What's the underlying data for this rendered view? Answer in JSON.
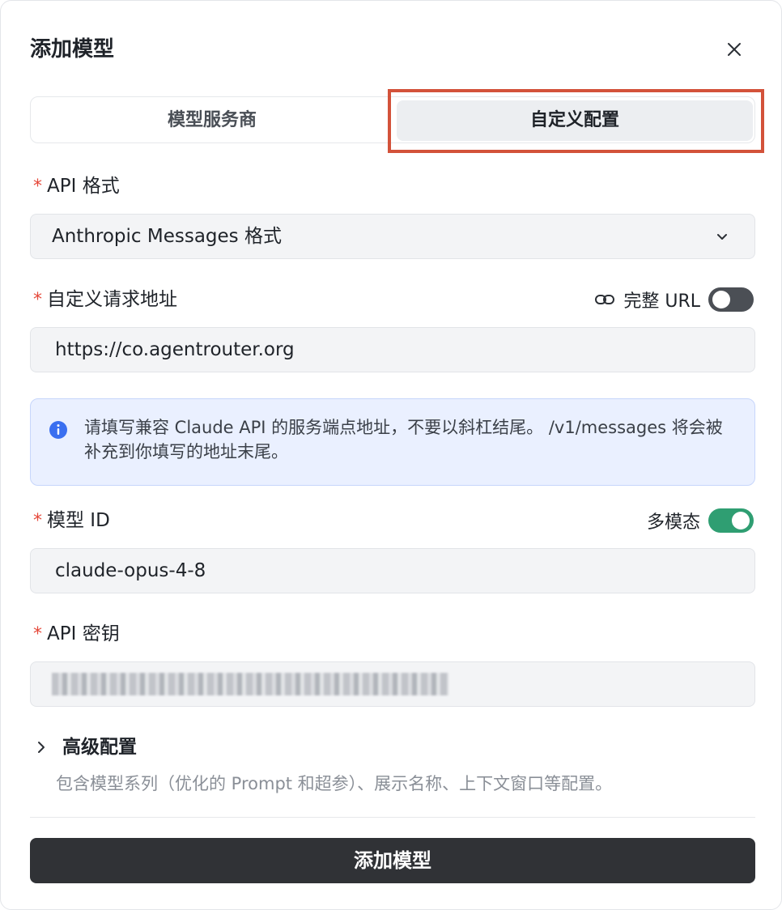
{
  "dialog": {
    "title": "添加模型",
    "close_icon": "close-icon"
  },
  "tabs": {
    "provider": "模型服务商",
    "custom": "自定义配置",
    "active": "custom"
  },
  "api_format": {
    "required": "*",
    "label": "API 格式",
    "value": "Anthropic Messages 格式",
    "icon": "chevron-down-icon"
  },
  "endpoint": {
    "required": "*",
    "label": "自定义请求地址",
    "full_url_label": "完整 URL",
    "full_url_icon": "link-icon",
    "full_url_enabled": false,
    "value": "https://co.agentrouter.org"
  },
  "info": {
    "icon": "info-icon",
    "text": "请填写兼容 Claude API 的服务端点地址，不要以斜杠结尾。 /v1/messages 将会被补充到你填写的地址末尾。"
  },
  "model_id": {
    "required": "*",
    "label": "模型 ID",
    "multimodal_label": "多模态",
    "multimodal_enabled": true,
    "value": "claude-opus-4-8"
  },
  "api_key": {
    "required": "*",
    "label": "API 密钥"
  },
  "advanced": {
    "icon": "chevron-right-icon",
    "title": "高级配置",
    "description": "包含模型系列（优化的 Prompt 和超参）、展示名称、上下文窗口等配置。"
  },
  "submit": {
    "label": "添加模型"
  },
  "colors": {
    "required_star": "#e5483a",
    "toggle_on": "#2f9e72",
    "toggle_off": "#4b4f55",
    "highlight_box": "#d3523a",
    "info_accent": "#3a6ff0",
    "primary_button": "#303236"
  }
}
